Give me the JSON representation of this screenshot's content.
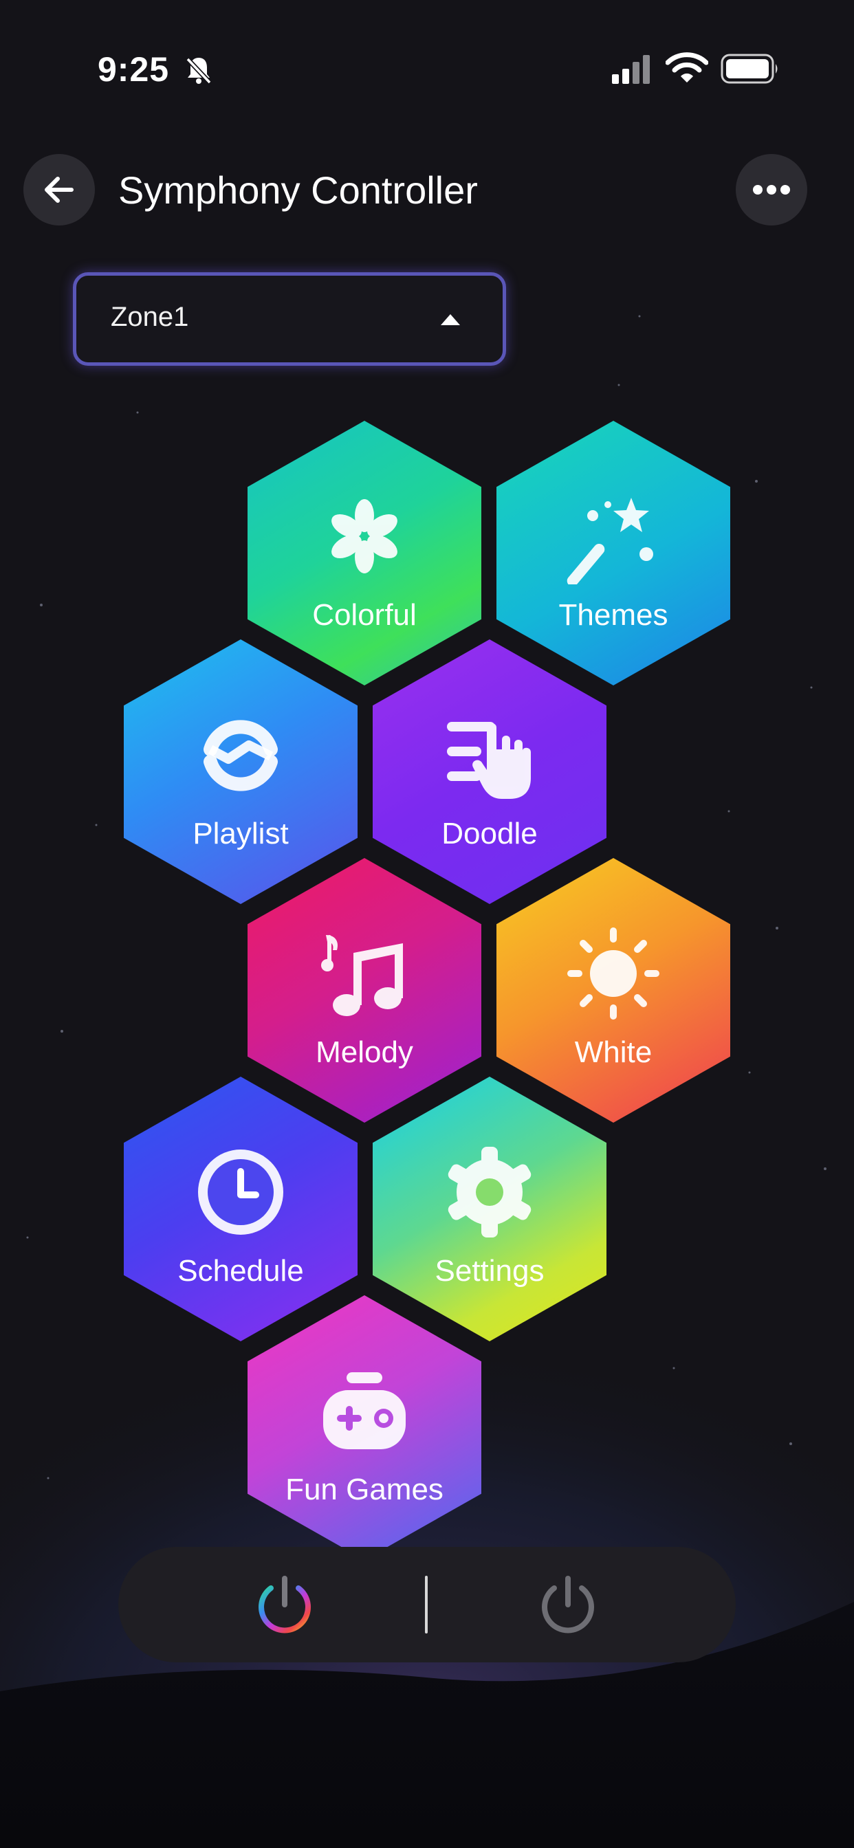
{
  "status_bar": {
    "time": "9:25",
    "icons": [
      "bell-slash-icon",
      "signal-icon",
      "wifi-icon",
      "battery-icon"
    ]
  },
  "header": {
    "title": "Symphony Controller",
    "back_icon": "arrow-left-icon",
    "more_icon": "ellipsis-icon"
  },
  "zone_selector": {
    "value": "Zone1",
    "caret_icon": "caret-up-icon",
    "border_color": "#5a56b8"
  },
  "tiles": [
    {
      "label": "Colorful",
      "icon": "flower-icon"
    },
    {
      "label": "Themes",
      "icon": "magic-wand-icon"
    },
    {
      "label": "Playlist",
      "icon": "loop-icon"
    },
    {
      "label": "Doodle",
      "icon": "hand-swipe-icon"
    },
    {
      "label": "Melody",
      "icon": "music-note-icon"
    },
    {
      "label": "White",
      "icon": "sun-icon"
    },
    {
      "label": "Schedule",
      "icon": "clock-icon"
    },
    {
      "label": "Settings",
      "icon": "gear-icon"
    },
    {
      "label": "Fun Games",
      "icon": "gamepad-icon"
    }
  ],
  "power_bar": {
    "left_icon": "power-rainbow-icon",
    "right_icon": "power-icon"
  },
  "colors": {
    "background": "#141318",
    "card": "#2c2b31",
    "power_bar": "#1f1e23"
  }
}
